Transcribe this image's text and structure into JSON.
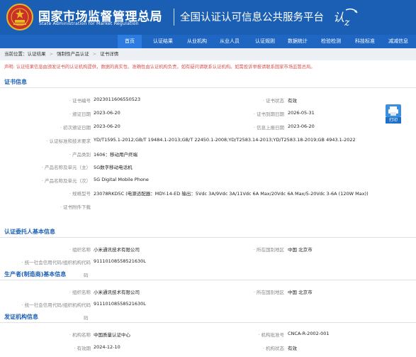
{
  "header": {
    "title_cn": "国家市场监督管理总局",
    "title_en": "State Administration  for  Market Regulation",
    "platform": "全国认证认可信息公共服务平台"
  },
  "nav": {
    "items": [
      "首页",
      "认证结果",
      "从业机构",
      "从业人员",
      "认证规则",
      "数据统计",
      "检验检测",
      "科技标准",
      "减减信息"
    ],
    "active_index": 0
  },
  "breadcrumb": {
    "prefix": "当前位置：认证结果",
    "sep": ">",
    "level2": "强制性产品认证",
    "level3": "证书详情"
  },
  "notice": "声明: 认证结果信息由颁发证书的认证机构提供，数据的真实性、准确性由认证机构负责，如有疑问请联系认证机构。如需投诉举报请联系国家市场监管总局。",
  "cert": {
    "section_title": "证书信息",
    "cert_no_label": "证书编号",
    "cert_no": "2023011606550523",
    "status_label": "证书状态",
    "status": "有效",
    "issue_date_label": "颁证日期",
    "issue_date": "2023-06-20",
    "expiry_label": "证书到期日期",
    "expiry": "2026-05-31",
    "first_date_label": "初次颁证日期",
    "first_date": "2023-06-20",
    "upload_label": "信息上报日期",
    "upload": "2023-06-20",
    "standard_label": "认证标准和技术要求",
    "standard": "YD/T1595.1-2012;GB/T 19484.1-2013;GB/T 22450.1-2008;YD/T2583.14-2013;YD/T2583.18-2019;GB 4943.1-2022",
    "category_label": "产品类别",
    "category": "1606：移动用户终端",
    "name_main_label": "产品名称及单元（主）",
    "name_main": "5G数字移动电话机",
    "name_sub_label": "产品名称及单元（次）",
    "name_sub": "5G Digital Mobile Phone",
    "model_label": "规格型号",
    "model": "23078RKD5C (电源适配器：MDY-14-ED 输出：5Vdc 3A/9Vdc 3A/11Vdc 6A Max/20Vdc 6A Max/5-20Vdc 3-6A (120W Max))",
    "attach_label": "证书附件下载",
    "print_label": "打印"
  },
  "client": {
    "section_title": "认证委托人基本信息",
    "org_label": "组织名称",
    "org": "小米通讯技术有限公司",
    "region_label": "所在国别地区",
    "region": "中国 北京市",
    "code_label": "统一社会信用代码/组织机构代码",
    "code": "91110108558521630L"
  },
  "maker": {
    "section_title": "生产者(制造商)基本信息",
    "extra": "码",
    "org_label": "组织名称",
    "org": "小米通讯技术有限公司",
    "region_label": "所在国别地区",
    "region": "中国 北京市",
    "code_label": "统一社会信用代码/组织机构代码",
    "code": "91110108558521630L"
  },
  "issuer": {
    "section_title": "发证机构信息",
    "extra": "码",
    "name_label": "机构名称",
    "name": "中国质量认证中心",
    "no_label": "机构批准号",
    "no": "CNCA-R-2002-001",
    "valid_label": "有效期",
    "valid": "2024-12-10",
    "status_label": "机构状态",
    "status": "有效"
  },
  "colors": {
    "header": "#1a5fb4",
    "nav": "#1e66c2",
    "notice": "#d9534f",
    "section": "#1a5fb4"
  }
}
